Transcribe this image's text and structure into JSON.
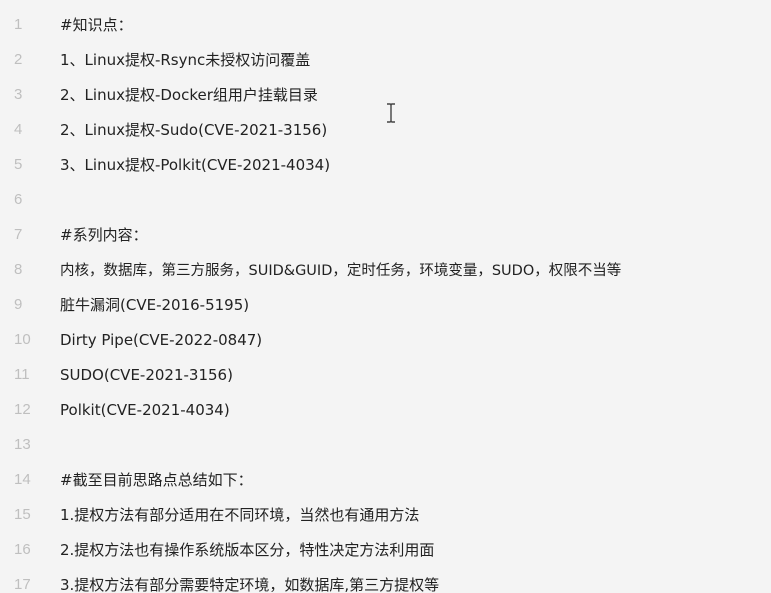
{
  "editor": {
    "lines": [
      {
        "num": "1",
        "text": "#知识点："
      },
      {
        "num": "2",
        "text": "1、Linux提权-Rsync未授权访问覆盖"
      },
      {
        "num": "3",
        "text": "2、Linux提权-Docker组用户挂载目录"
      },
      {
        "num": "4",
        "text": "2、Linux提权-Sudo(CVE-2021-3156)"
      },
      {
        "num": "5",
        "text": "3、Linux提权-Polkit(CVE-2021-4034)"
      },
      {
        "num": "6",
        "text": ""
      },
      {
        "num": "7",
        "text": "#系列内容："
      },
      {
        "num": "8",
        "text": "内核，数据库，第三方服务，SUID&GUID，定时任务，环境变量，SUDO，权限不当等"
      },
      {
        "num": "9",
        "text": "脏牛漏洞(CVE-2016-5195)"
      },
      {
        "num": "10",
        "text": "Dirty Pipe(CVE-2022-0847)"
      },
      {
        "num": "11",
        "text": "SUDO(CVE-2021-3156)"
      },
      {
        "num": "12",
        "text": "Polkit(CVE-2021-4034)"
      },
      {
        "num": "13",
        "text": ""
      },
      {
        "num": "14",
        "text": "#截至目前思路点总结如下："
      },
      {
        "num": "15",
        "text": "1.提权方法有部分适用在不同环境，当然也有通用方法"
      },
      {
        "num": "16",
        "text": "2.提权方法也有操作系统版本区分，特性决定方法利用面"
      },
      {
        "num": "17",
        "text": "3.提权方法有部分需要特定环境，如数据库,第三方提权等"
      }
    ]
  },
  "cursor_icon": "text-cursor-icon"
}
